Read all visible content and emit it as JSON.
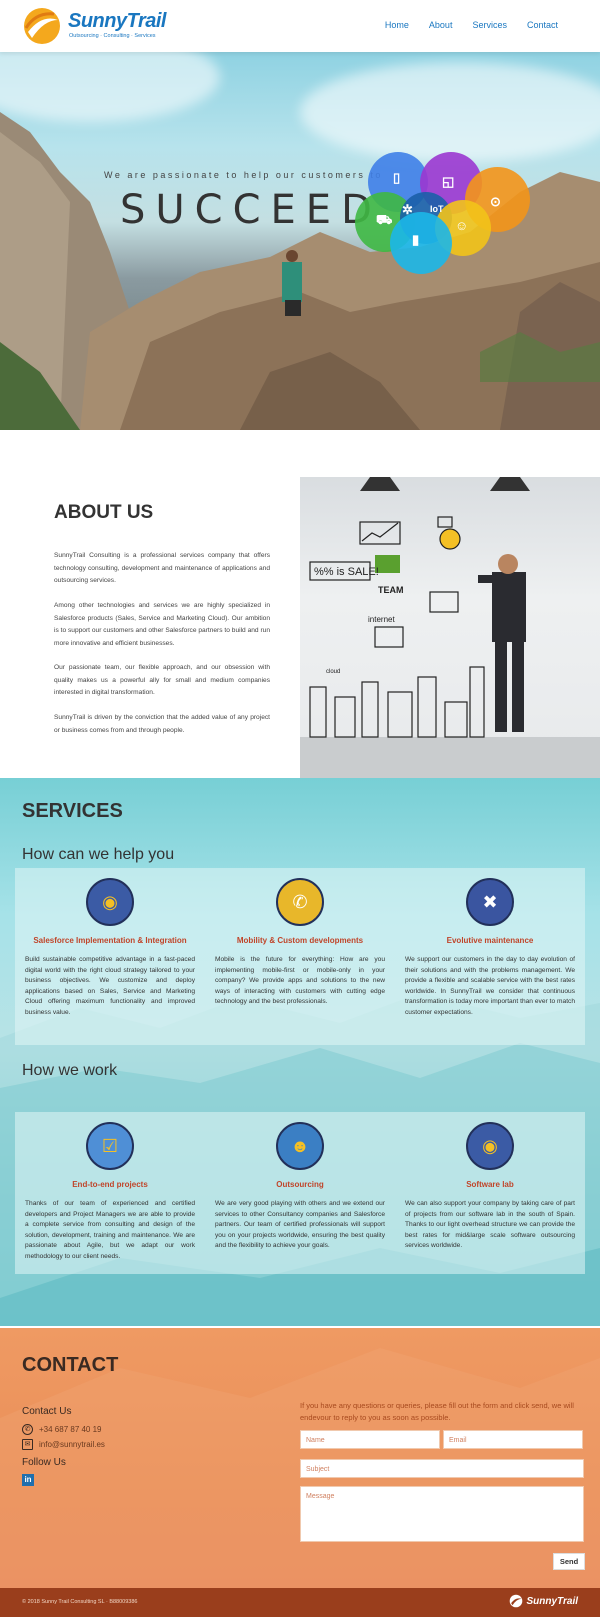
{
  "header": {
    "brand": "SunnyTrail",
    "tagline": "Outsourcing · Consulting · Services",
    "nav": [
      "Home",
      "About",
      "Services",
      "Contact"
    ]
  },
  "hero": {
    "tagline": "We are passionate to help our customers to",
    "headline": "SUCCEED",
    "bubble_icons": [
      "mobile-icon",
      "chat-icon",
      "location-icon",
      "cart-icon",
      "gear-icon",
      "iot-label",
      "users-icon",
      "bar-chart-icon"
    ],
    "iot_text": "IoT",
    "colors": {
      "blue": "#3f7fe8",
      "purple": "#9b37d0",
      "orange": "#f3951a",
      "green": "#3fb844",
      "cyan": "#1cb7e8",
      "yellow": "#f2c31a"
    }
  },
  "about": {
    "title": "ABOUT US",
    "paragraphs": [
      "SunnyTrail Consulting is a professional services company that offers technology consulting, development and maintenance of applications and outsourcing services.",
      "Among other technologies and services we are highly specialized in Salesforce products (Sales, Service and Marketing Cloud). Our ambition is to support our customers and other Salesforce partners to build and run more innovative and efficient businesses.",
      "Our passionate team, our flexible approach, and our obsession with quality makes us a powerful ally for small and medium companies interested in digital transformation.",
      "SunnyTrail is driven by the conviction that the added value of any project or business comes from and through people."
    ],
    "image_labels": [
      "%% is SALE!",
      "TEAM",
      "internet",
      "cloud"
    ]
  },
  "services": {
    "title": "SERVICES",
    "help_title": "How can we help you",
    "help_cards": [
      {
        "icon": "submarine-icon",
        "title": "Salesforce Implementation & Integration",
        "text": "Build sustainable competitive advantage in a fast-paced digital world with the right cloud strategy tailored to your business objectives. We customize and deploy applications based on Sales, Service and Marketing Cloud offering maximum functionality and improved business value."
      },
      {
        "icon": "mobile-compass-icon",
        "title": "Mobility & Custom developments",
        "text": "Mobile is the future for everything: How are you implementing mobile-first or mobile-only in your company? We provide apps and solutions to the new ways of interacting with customers with cutting edge technology and the best professionals."
      },
      {
        "icon": "tools-icon",
        "title": "Evolutive maintenance",
        "text": "We support our customers in the day to day evolution of their solutions and with the problems management. We provide a flexible and scalable service with the best rates worldwide. In SunnyTrail we consider that continuous transformation is today more important than ever to match customer expectations."
      }
    ],
    "work_title": "How we work",
    "work_cards": [
      {
        "icon": "checklist-icon",
        "title": "End-to-end projects",
        "text": "Thanks of our team of experienced and certified developers and Project Managers we are able to provide a complete service from consulting and design of the solution, development, training and maintenance. We are passionate about Agile, but we adapt our work methodology to our client needs."
      },
      {
        "icon": "diver-icon",
        "title": "Outsourcing",
        "text": "We are very good playing with others and we extend our services to other Consultancy companies and Salesforce partners. Our team of certified professionals will support you on your projects worldwide, ensuring the best quality and the flexibility to achieve your goals."
      },
      {
        "icon": "submarine-icon",
        "title": "Software lab",
        "text": "We can also support your company by taking care of part of projects from our software lab in the south of Spain. Thanks to our light overhead structure we can provide the best rates for mid&large scale software outsourcing services worldwide."
      }
    ]
  },
  "contact": {
    "title": "CONTACT",
    "contact_us": "Contact Us",
    "phone": "+34 687 87 40 19",
    "email": "info@sunnytrail.es",
    "follow_us": "Follow Us",
    "linkedin": "in",
    "intro": "If you have any questions or queries, please fill out the form and click send, we will endevour to reply to you as soon as possible.",
    "form": {
      "name_placeholder": "Name",
      "email_placeholder": "Email",
      "subject_placeholder": "Subject",
      "message_placeholder": "Message",
      "send_label": "Send"
    }
  },
  "footer": {
    "copyright": "© 2018 Sunny Trail Consulting SL · B88009386",
    "logo": "SunnyTrail"
  }
}
